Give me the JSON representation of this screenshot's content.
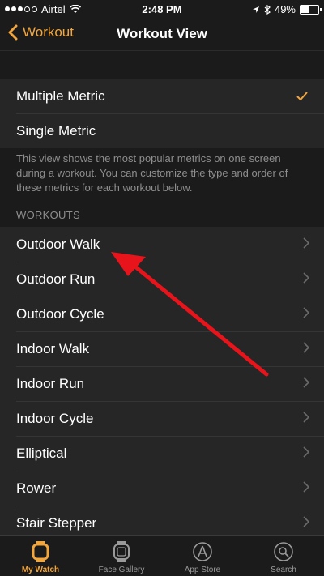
{
  "status_bar": {
    "carrier": "Airtel",
    "time": "2:48 PM",
    "battery_text": "49%",
    "battery_level": 0.49
  },
  "nav": {
    "back_label": "Workout",
    "title": "Workout View"
  },
  "view_options": [
    {
      "label": "Multiple Metric",
      "selected": true
    },
    {
      "label": "Single Metric",
      "selected": false
    }
  ],
  "description": "This view shows the most popular metrics on one screen during a workout. You can customize the type and order of these metrics for each workout below.",
  "workouts_header": "WORKOUTS",
  "workouts": [
    "Outdoor Walk",
    "Outdoor Run",
    "Outdoor Cycle",
    "Indoor Walk",
    "Indoor Run",
    "Indoor Cycle",
    "Elliptical",
    "Rower",
    "Stair Stepper"
  ],
  "tabs": [
    {
      "label": "My Watch",
      "icon": "watch-icon",
      "active": true
    },
    {
      "label": "Face Gallery",
      "icon": "face-gallery-icon",
      "active": false
    },
    {
      "label": "App Store",
      "icon": "app-store-icon",
      "active": false
    },
    {
      "label": "Search",
      "icon": "search-icon",
      "active": false
    }
  ],
  "colors": {
    "accent": "#f2a63b",
    "background": "#1b1b1b",
    "cell": "#262626",
    "annotation": "#e8141b"
  }
}
